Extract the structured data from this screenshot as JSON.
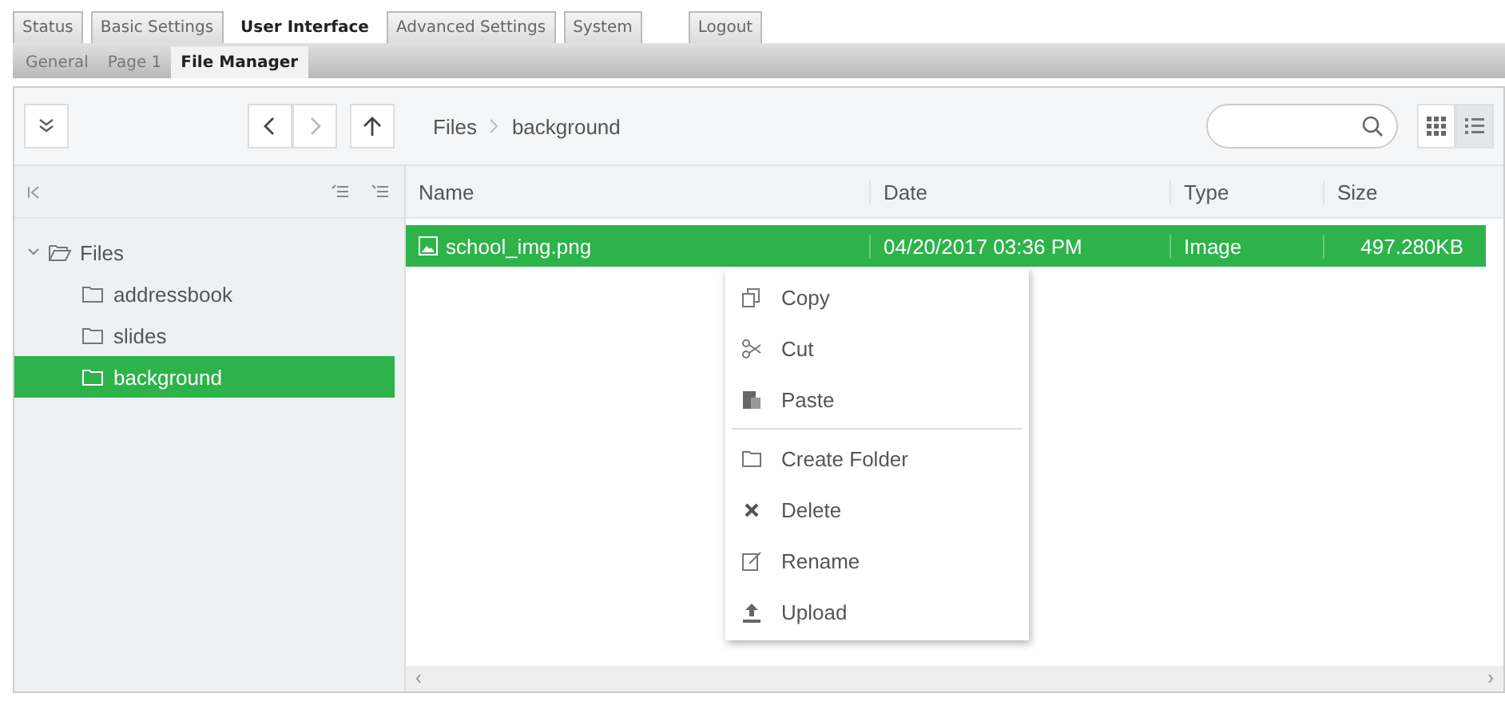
{
  "main_tabs": [
    {
      "label": "Status",
      "selected": false
    },
    {
      "label": "Basic Settings",
      "selected": false
    },
    {
      "label": "User Interface",
      "selected": true
    },
    {
      "label": "Advanced Settings",
      "selected": false
    },
    {
      "label": "System",
      "selected": false
    }
  ],
  "logout": "Logout",
  "sub_tabs": [
    {
      "label": "General",
      "selected": false
    },
    {
      "label": "Page 1",
      "selected": false
    },
    {
      "label": "File Manager",
      "selected": true
    }
  ],
  "breadcrumb": [
    "Files",
    "background"
  ],
  "tree": [
    {
      "label": "Files",
      "expanded": true,
      "selected": false,
      "children": [
        {
          "label": "addressbook",
          "selected": false
        },
        {
          "label": "slides",
          "selected": false
        },
        {
          "label": "background",
          "selected": true
        }
      ]
    }
  ],
  "columns": [
    "Name",
    "Date",
    "Type",
    "Size"
  ],
  "rows": [
    {
      "name": "school_img.png",
      "date": "04/20/2017 03:36 PM",
      "type": "Image",
      "size": "497.280KB",
      "selected": true
    }
  ],
  "context_menu": [
    {
      "kind": "item",
      "label": "Copy"
    },
    {
      "kind": "item",
      "label": "Cut"
    },
    {
      "kind": "item",
      "label": "Paste"
    },
    {
      "kind": "separator"
    },
    {
      "kind": "item",
      "label": "Create Folder"
    },
    {
      "kind": "item",
      "label": "Delete"
    },
    {
      "kind": "item",
      "label": "Rename"
    },
    {
      "kind": "item",
      "label": "Upload"
    }
  ]
}
